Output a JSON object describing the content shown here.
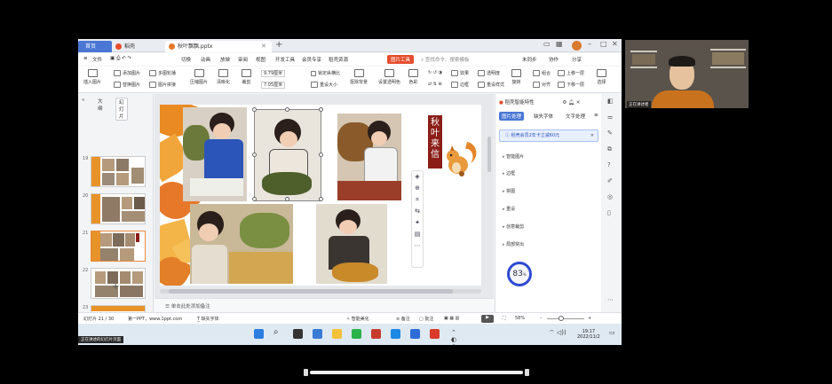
{
  "titlebar": {
    "home_tab": "首页",
    "daoke_tab": "稻壳",
    "file_tab": "秋叶飘飘.pptx",
    "plus": "+"
  },
  "menubar": {
    "file": "文件",
    "items": [
      "开始",
      "插入",
      "切换",
      "动画",
      "放映",
      "审阅",
      "视图",
      "开发工具",
      "会员专享",
      "稻壳资源"
    ],
    "active": "图片工具",
    "search": "查找命令、搜索模板",
    "unsync": "未同步",
    "collab": "协作",
    "share": "分享"
  },
  "ribbon": {
    "insert_image": "插入图片",
    "add_image": "添加图片",
    "replace_image": "替换图片",
    "multi_image": "多图轮播",
    "image_mosaic": "图片拼接",
    "compress": "压缩图片",
    "sharpen": "清晰化",
    "crop": "裁剪",
    "height": "9.79厘米",
    "width": "7.05厘米",
    "lock_ratio": "锁定纵横比",
    "reset_size": "重设大小",
    "remove_bg": "抠除背景",
    "transparency": "设置透明色",
    "color": "色彩",
    "effect": "效果",
    "border": "边框",
    "alpha": "透明度",
    "reset_style": "重设样式",
    "rotate": "旋转",
    "group": "组合",
    "align": "对齐",
    "bring_forward": "上移一层",
    "send_backward": "下移一层",
    "select": "选择"
  },
  "left_panel": {
    "tab_outline": "大纲",
    "tab_slides": "幻灯片",
    "slide_numbers": [
      "19",
      "20",
      "21",
      "22",
      "23"
    ],
    "add": "+"
  },
  "slide": {
    "title": "秋叶来信"
  },
  "notes": {
    "placeholder": "单击此处添加备注"
  },
  "right_panel": {
    "header": "稻壳智能特性",
    "tabs": [
      "图片处理",
      "缺失字体",
      "文字处理"
    ],
    "promo": "稻壳会员2年卡立减60元",
    "items": [
      "智能图片",
      "边框",
      "拼图",
      "重设",
      "创意裁剪",
      "局部突出"
    ],
    "score": "83",
    "score_unit": "%"
  },
  "statusbar": {
    "slide_count": "幻灯片 21 / 30",
    "theme": "第一PPT，www.1ppt.com",
    "missing_font": "缺失字体",
    "beautify": "智能美化",
    "notes": "备注",
    "comment": "批注",
    "zoom": "58%"
  },
  "taskbar": {
    "time": "19:17",
    "date": "2022/11/2",
    "label": "正在讲述的幻灯片页面"
  },
  "webcam": {
    "label": "正在讲述者"
  }
}
